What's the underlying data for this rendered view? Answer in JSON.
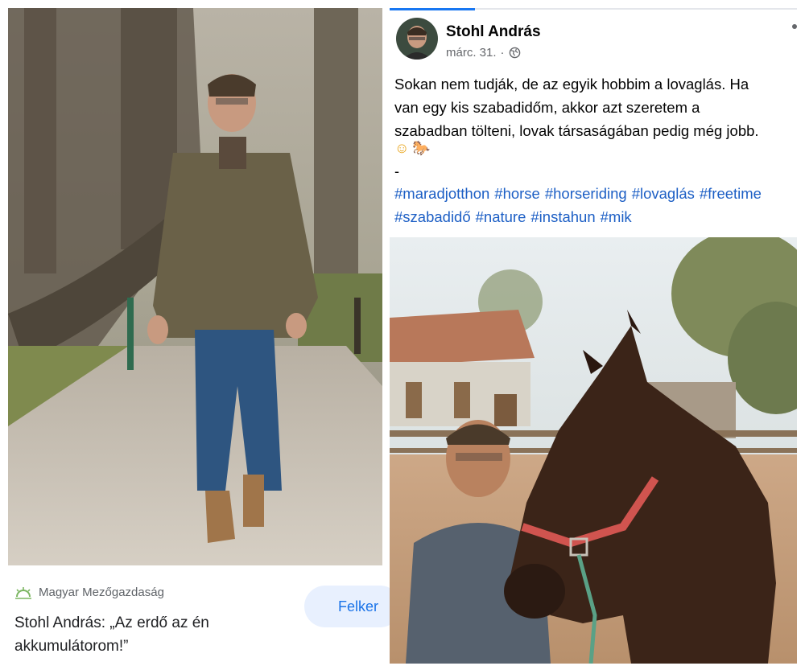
{
  "left": {
    "source": "Magyar Mezőgazdaság",
    "title": "Stohl András: „Az erdő az én akkumulátorom!”",
    "follow_label": "Felker"
  },
  "right": {
    "author": "Stohl András",
    "date": "márc. 31.",
    "separator": "·",
    "text": "Sokan nem tudják, de az egyik hobbim a lovaglás. Ha\nvan egy kis szabadidőm, akkor azt szeretem a\nszabadban tölteni, lovak társaságában pedig még jobb.",
    "emojis": [
      "☺",
      "🐎"
    ],
    "dash": "-",
    "hashtags_line1": [
      "#maradjotthon",
      "#horse",
      "#horseriding",
      "#lovaglás",
      "#freetime"
    ],
    "hashtags_line2": [
      "#szabadidő",
      "#nature",
      "#instahun",
      "#mik"
    ]
  },
  "colors": {
    "link": "#1d5fc5",
    "follow_bg": "#e8f0fe",
    "follow_text": "#1a73e8",
    "fb_blue": "#1877f2"
  },
  "icons": [
    "sunrise-logo-icon",
    "globe-icon",
    "more-options-icon"
  ]
}
